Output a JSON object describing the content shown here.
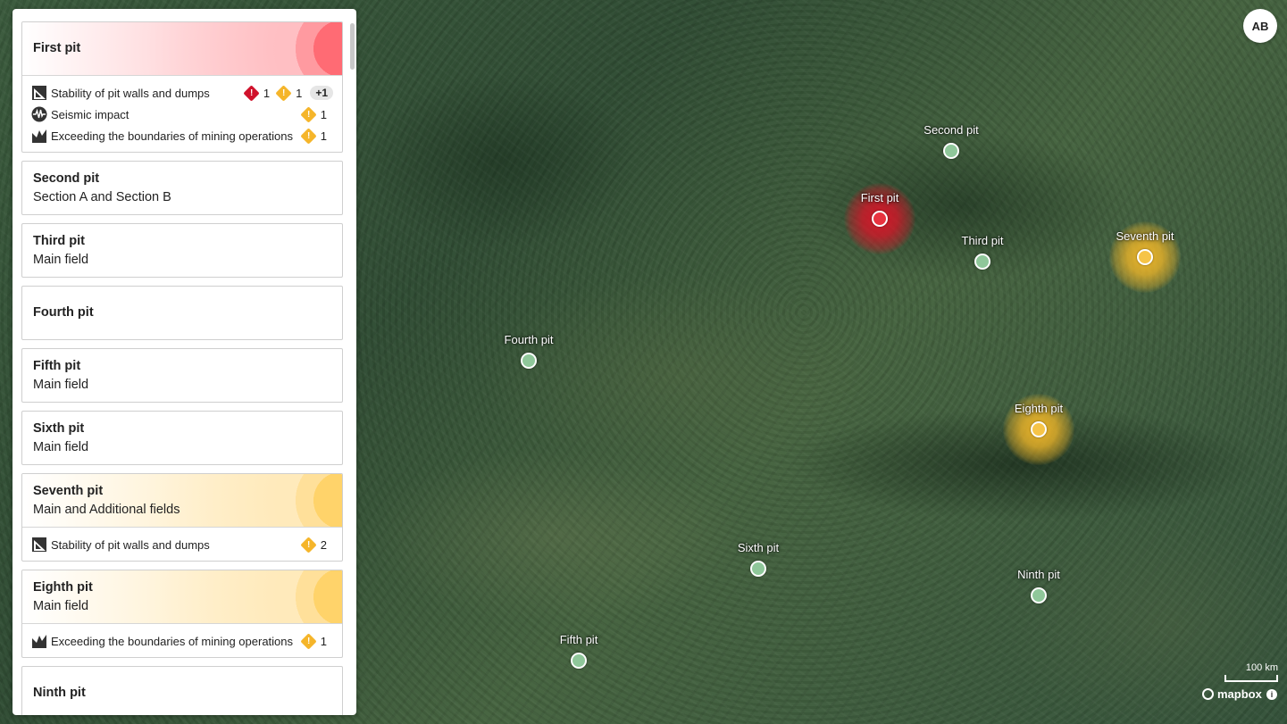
{
  "map": {
    "pits": [
      {
        "name": "First pit",
        "status": "red"
      },
      {
        "name": "Second pit",
        "status": "green"
      },
      {
        "name": "Third pit",
        "status": "green"
      },
      {
        "name": "Fourth pit",
        "status": "green"
      },
      {
        "name": "Fifth pit",
        "status": "green"
      },
      {
        "name": "Sixth pit",
        "status": "green"
      },
      {
        "name": "Seventh pit",
        "status": "yellow"
      },
      {
        "name": "Eighth pit",
        "status": "yellow"
      },
      {
        "name": "Ninth pit",
        "status": "green"
      }
    ],
    "scale_label": "100 km",
    "attribution": "mapbox",
    "colors": {
      "red": "#e8323f",
      "yellow": "#f6c448",
      "green": "#8fc79a"
    }
  },
  "user": {
    "initials": "AB"
  },
  "sidebar": {
    "cards": [
      {
        "title": "First pit",
        "subtitle": "",
        "status": "red",
        "issues": [
          {
            "icon": "slope-icon",
            "label": "Stability of pit walls and dumps",
            "critical": "1",
            "warning": "1",
            "more": "+1"
          },
          {
            "icon": "seismic-icon",
            "label": "Seismic impact",
            "warning": "1"
          },
          {
            "icon": "boundary-icon",
            "label": "Exceeding the boundaries of mining operations",
            "warning": "1"
          }
        ]
      },
      {
        "title": "Second pit",
        "subtitle": "Section A and Section B",
        "status": "green"
      },
      {
        "title": "Third pit",
        "subtitle": "Main field",
        "status": "green"
      },
      {
        "title": "Fourth pit",
        "subtitle": "",
        "status": "green"
      },
      {
        "title": "Fifth pit",
        "subtitle": "Main field",
        "status": "green"
      },
      {
        "title": "Sixth pit",
        "subtitle": "Main field",
        "status": "green"
      },
      {
        "title": "Seventh pit",
        "subtitle": "Main and Additional fields",
        "status": "yellow",
        "issues": [
          {
            "icon": "slope-icon",
            "label": "Stability of pit walls and dumps",
            "warning": "2"
          }
        ]
      },
      {
        "title": "Eighth pit",
        "subtitle": "Main field",
        "status": "yellow",
        "issues": [
          {
            "icon": "boundary-icon",
            "label": "Exceeding the boundaries of mining operations",
            "warning": "1"
          }
        ]
      },
      {
        "title": "Ninth pit",
        "subtitle": "",
        "status": "green"
      }
    ]
  }
}
